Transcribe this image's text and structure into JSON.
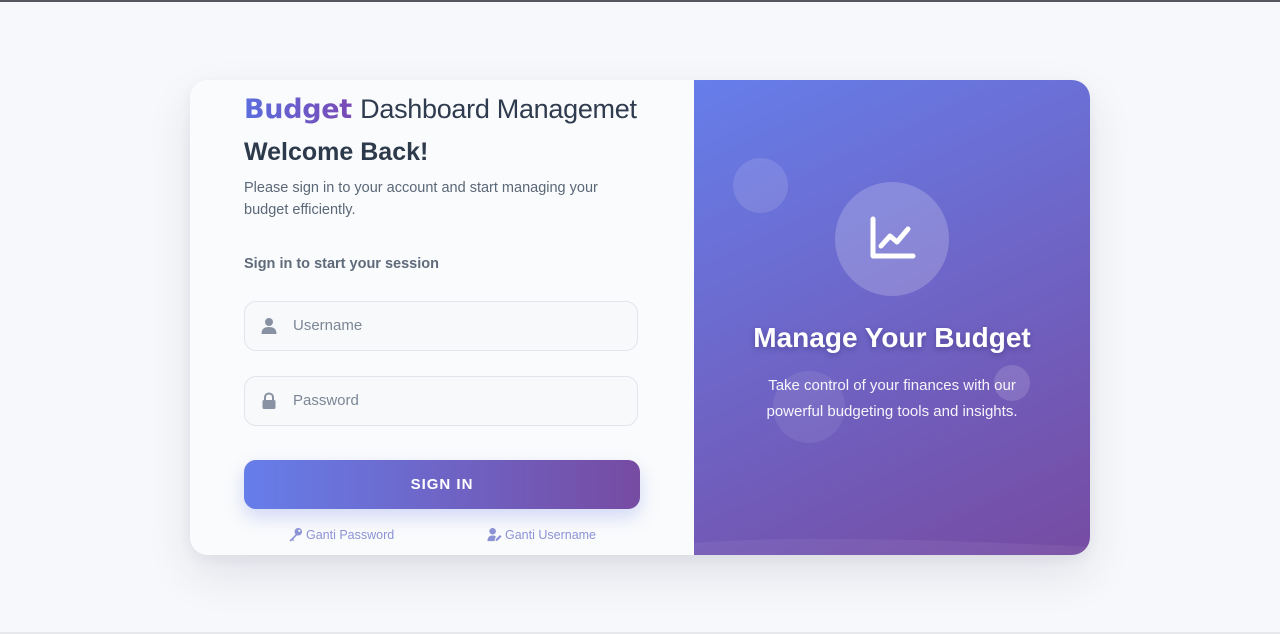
{
  "brand": {
    "accent": "Budget",
    "rest": "Dashboard Managemet"
  },
  "login": {
    "welcome": "Welcome Back!",
    "subtitle": "Please sign in to your account and start managing your budget efficiently.",
    "session_label": "Sign in to start your session",
    "username_placeholder": "Username",
    "password_placeholder": "Password",
    "sign_in_label": "SIGN IN",
    "change_password_label": "Ganti Password",
    "change_username_label": "Ganti Username"
  },
  "promo": {
    "title": "Manage Your Budget",
    "description": "Take control of your finances with our powerful budgeting tools and insights."
  },
  "icons": {
    "username": "user-icon",
    "password": "lock-icon",
    "change_password": "key-icon",
    "change_username": "user-edit-icon",
    "promo": "chart-line-icon"
  },
  "colors": {
    "gradient_start": "#667eea",
    "gradient_end": "#764ba2",
    "text_dark": "#2c3a4c",
    "link": "#8b93d6"
  }
}
